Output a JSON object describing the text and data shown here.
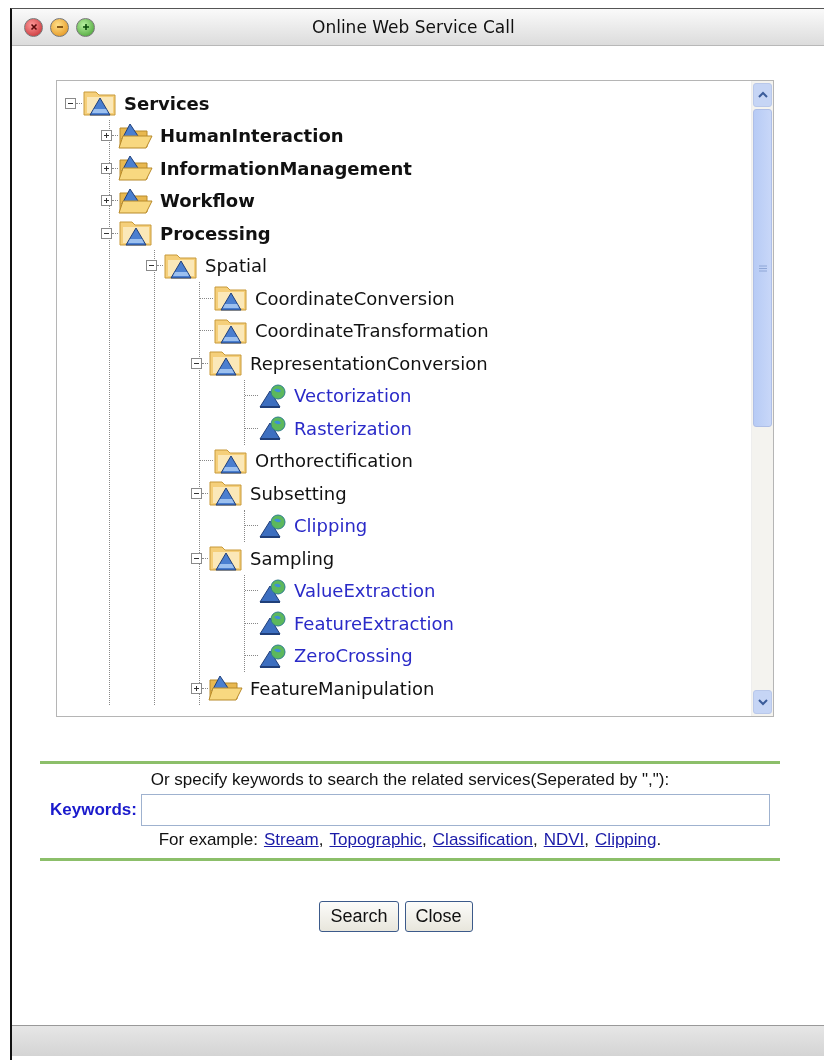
{
  "window": {
    "title": "Online Web Service Call"
  },
  "tree": [
    {
      "label": "Services",
      "kind": "category",
      "expanded": true,
      "children": [
        {
          "label": "HumanInteraction",
          "kind": "category",
          "expanded": false
        },
        {
          "label": "InformationManagement",
          "kind": "category",
          "expanded": false
        },
        {
          "label": "Workflow",
          "kind": "category",
          "expanded": false
        },
        {
          "label": "Processing",
          "kind": "category",
          "expanded": true,
          "children": [
            {
              "label": "Spatial",
              "kind": "category",
              "expanded": true,
              "children": [
                {
                  "label": "CoordinateConversion",
                  "kind": "category"
                },
                {
                  "label": "CoordinateTransformation",
                  "kind": "category"
                },
                {
                  "label": "RepresentationConversion",
                  "kind": "category",
                  "expanded": true,
                  "children": [
                    {
                      "label": "Vectorization",
                      "kind": "service"
                    },
                    {
                      "label": "Rasterization",
                      "kind": "service"
                    }
                  ]
                },
                {
                  "label": "Orthorectification",
                  "kind": "category"
                },
                {
                  "label": "Subsetting",
                  "kind": "category",
                  "expanded": true,
                  "children": [
                    {
                      "label": "Clipping",
                      "kind": "service"
                    }
                  ]
                },
                {
                  "label": "Sampling",
                  "kind": "category",
                  "expanded": true,
                  "children": [
                    {
                      "label": "ValueExtraction",
                      "kind": "service"
                    },
                    {
                      "label": "FeatureExtraction",
                      "kind": "service"
                    },
                    {
                      "label": "ZeroCrossing",
                      "kind": "service"
                    }
                  ]
                },
                {
                  "label": "FeatureManipulation",
                  "kind": "category",
                  "expanded": false
                }
              ]
            }
          ]
        }
      ]
    }
  ],
  "search": {
    "instruction": "Or specify keywords to search the related services(Seperated by \",\"):",
    "keywords_label": "Keywords:",
    "examples_label": "For example:",
    "examples": [
      {
        "label": "Stream",
        "after": ","
      },
      {
        "label": "Topographic",
        "after": ","
      },
      {
        "label": "Classification",
        "after": ","
      },
      {
        "label": "NDVI",
        "after": ","
      },
      {
        "label": "Clipping",
        "after": "."
      }
    ]
  },
  "buttons": [
    "Search",
    "Close"
  ]
}
